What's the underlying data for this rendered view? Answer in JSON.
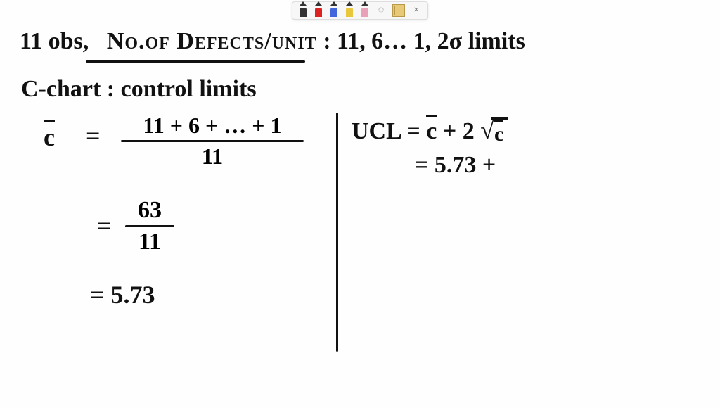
{
  "toolbar": {
    "pens": [
      "#333333",
      "#d22",
      "#46d",
      "#e8c83a",
      "#e8a1b8"
    ],
    "lasso_icon": "◌",
    "close_icon": "×"
  },
  "notes": {
    "line1_a": "11 obs,",
    "line1_b": "No.of Defects/unit",
    "line1_c": ": 11, 6… 1, 2σ limits",
    "line2": "C-chart : control limits",
    "cbar_symbol": "c",
    "eq": "=",
    "frac1_num": "11 + 6 + … + 1",
    "frac1_den": "11",
    "frac2_num": "63",
    "frac2_den": "11",
    "result": "= 5.73",
    "ucl_label": "UCL = ",
    "plus2": " + 2",
    "ucl_value": "= 5.73 +"
  }
}
